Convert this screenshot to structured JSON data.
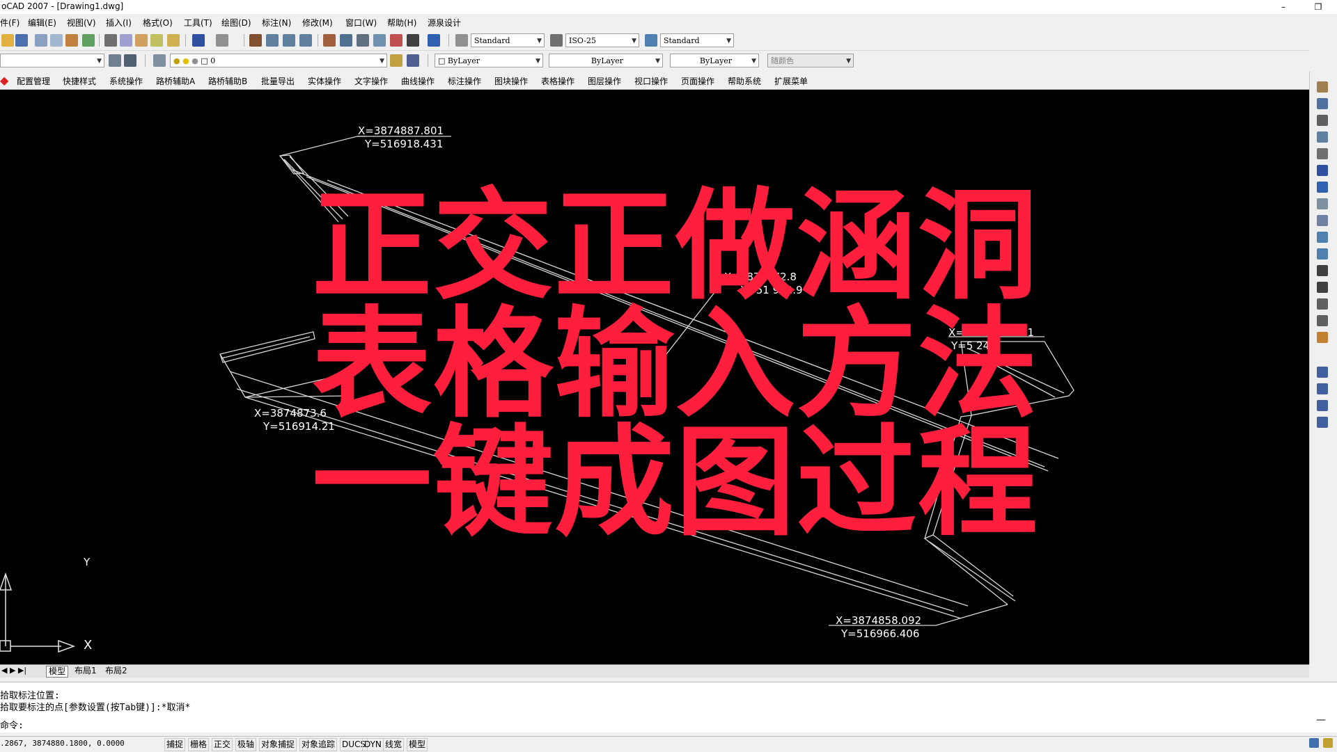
{
  "window": {
    "title": "oCAD 2007 - [Drawing1.dwg]",
    "minimize": "–",
    "restore": "❐"
  },
  "menu": [
    "件(F)",
    "编辑(E)",
    "视图(V)",
    "插入(I)",
    "格式(O)",
    "工具(T)",
    "绘图(D)",
    "标注(N)",
    "修改(M)",
    "窗口(W)",
    "帮助(H)",
    "源泉设计"
  ],
  "toolbar1": {
    "text_style": "Standard",
    "dim_style": "ISO-25",
    "table_style": "Standard"
  },
  "toolbar2": {
    "layer": "0",
    "color": "ByLayer",
    "linetype": "ByLayer",
    "lineweight": "ByLayer",
    "plot_style": "随颜色"
  },
  "custom_menu": [
    "配置管理",
    "快捷样式",
    "系统操作",
    "路桥辅助A",
    "路桥辅助B",
    "批量导出",
    "实体操作",
    "文字操作",
    "曲线操作",
    "标注操作",
    "图块操作",
    "表格操作",
    "图层操作",
    "视口操作",
    "页面操作",
    "帮助系统",
    "扩展菜单"
  ],
  "drawing": {
    "coords": [
      {
        "x": "X=3874887.801",
        "y": "Y=516918.431"
      },
      {
        "x": "X=3874872.8",
        "y": "Y=51 942.9"
      },
      {
        "x": "X=3874872.251",
        "y": "Y=5 24"
      },
      {
        "x": "X=3874873.6",
        "y": "Y=516914.21"
      },
      {
        "x": "X=3874858.092",
        "y": "Y=516966.406"
      }
    ],
    "ucs": {
      "x_label": "X",
      "y_label": "Y"
    }
  },
  "overlay_text": [
    "正交正做涵洞",
    "表格输入方法",
    "一键成图过程"
  ],
  "tabs": [
    "模型",
    "布局1",
    "布局2"
  ],
  "command": {
    "lines": [
      "拾取标注位置:",
      "拾取要标注的点[参数设置(按Tab键)]:*取消*"
    ],
    "prompt": "命令:"
  },
  "status": {
    "coords": ".2867, 3874880.1800, 0.0000",
    "buttons": [
      "捕捉",
      "栅格",
      "正交",
      "极轴",
      "对象捕捉",
      "对象追踪",
      "DUCS",
      "DYN",
      "线宽",
      "模型"
    ]
  },
  "colors": {
    "overlay": "#ff1f3d",
    "canvas": "#000000"
  }
}
